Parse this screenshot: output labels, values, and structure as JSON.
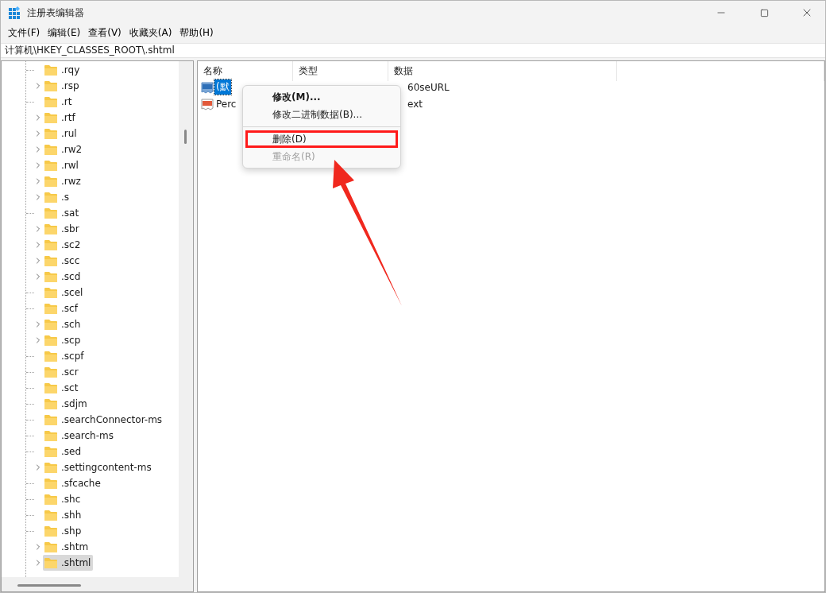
{
  "window": {
    "title": "注册表编辑器"
  },
  "menu": [
    "文件(F)",
    "编辑(E)",
    "查看(V)",
    "收藏夹(A)",
    "帮助(H)"
  ],
  "address": "计算机\\HKEY_CLASSES_ROOT\\.shtml",
  "tree": {
    "items": [
      {
        "label": ".rqy",
        "expandable": false,
        "selected": false
      },
      {
        "label": ".rsp",
        "expandable": true,
        "selected": false
      },
      {
        "label": ".rt",
        "expandable": false,
        "selected": false
      },
      {
        "label": ".rtf",
        "expandable": true,
        "selected": false
      },
      {
        "label": ".rul",
        "expandable": true,
        "selected": false
      },
      {
        "label": ".rw2",
        "expandable": true,
        "selected": false
      },
      {
        "label": ".rwl",
        "expandable": true,
        "selected": false
      },
      {
        "label": ".rwz",
        "expandable": true,
        "selected": false
      },
      {
        "label": ".s",
        "expandable": true,
        "selected": false
      },
      {
        "label": ".sat",
        "expandable": false,
        "selected": false
      },
      {
        "label": ".sbr",
        "expandable": true,
        "selected": false
      },
      {
        "label": ".sc2",
        "expandable": true,
        "selected": false
      },
      {
        "label": ".scc",
        "expandable": true,
        "selected": false
      },
      {
        "label": ".scd",
        "expandable": true,
        "selected": false
      },
      {
        "label": ".scel",
        "expandable": false,
        "selected": false
      },
      {
        "label": ".scf",
        "expandable": false,
        "selected": false
      },
      {
        "label": ".sch",
        "expandable": true,
        "selected": false
      },
      {
        "label": ".scp",
        "expandable": true,
        "selected": false
      },
      {
        "label": ".scpf",
        "expandable": false,
        "selected": false
      },
      {
        "label": ".scr",
        "expandable": false,
        "selected": false
      },
      {
        "label": ".sct",
        "expandable": false,
        "selected": false
      },
      {
        "label": ".sdjm",
        "expandable": false,
        "selected": false
      },
      {
        "label": ".searchConnector-ms",
        "expandable": false,
        "selected": false
      },
      {
        "label": ".search-ms",
        "expandable": false,
        "selected": false
      },
      {
        "label": ".sed",
        "expandable": false,
        "selected": false
      },
      {
        "label": ".settingcontent-ms",
        "expandable": true,
        "selected": false
      },
      {
        "label": ".sfcache",
        "expandable": false,
        "selected": false
      },
      {
        "label": ".shc",
        "expandable": false,
        "selected": false
      },
      {
        "label": ".shh",
        "expandable": false,
        "selected": false
      },
      {
        "label": ".shp",
        "expandable": false,
        "selected": false
      },
      {
        "label": ".shtm",
        "expandable": true,
        "selected": false
      },
      {
        "label": ".shtml",
        "expandable": true,
        "selected": true
      }
    ]
  },
  "values": {
    "columns": [
      "名称",
      "类型",
      "数据"
    ],
    "rows": [
      {
        "name": "(默",
        "data": "60seURL",
        "selected": true
      },
      {
        "name": "Perc",
        "data": "ext",
        "selected": false
      }
    ]
  },
  "context_menu": [
    {
      "kind": "item",
      "label": "修改(M)...",
      "default": true,
      "disabled": false,
      "highlighted": false
    },
    {
      "kind": "item",
      "label": "修改二进制数据(B)...",
      "default": false,
      "disabled": false,
      "highlighted": false
    },
    {
      "kind": "separator"
    },
    {
      "kind": "item",
      "label": "删除(D)",
      "default": false,
      "disabled": false,
      "highlighted": true
    },
    {
      "kind": "item",
      "label": "重命名(R)",
      "default": false,
      "disabled": true,
      "highlighted": false
    }
  ]
}
